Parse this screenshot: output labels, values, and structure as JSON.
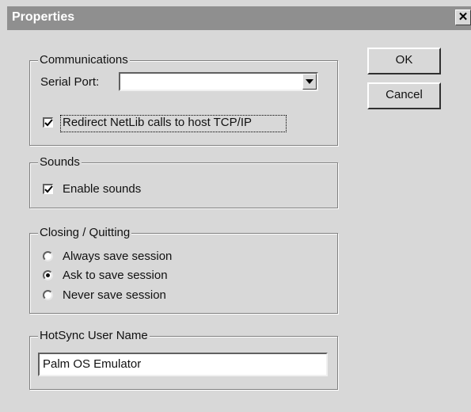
{
  "window": {
    "title": "Properties",
    "close_glyph": "✕"
  },
  "buttons": {
    "ok_label": "OK",
    "cancel_label": "Cancel"
  },
  "communications": {
    "group_label": "Communications",
    "serial_port_label": "Serial Port:",
    "serial_port_value": "",
    "redirect_label": "Redirect NetLib calls to host TCP/IP",
    "redirect_checked": true
  },
  "sounds": {
    "group_label": "Sounds",
    "enable_label": "Enable sounds",
    "enable_checked": true
  },
  "closing": {
    "group_label": "Closing / Quitting",
    "options": [
      {
        "label": "Always save session",
        "selected": false
      },
      {
        "label": "Ask to save session",
        "selected": true
      },
      {
        "label": "Never save session",
        "selected": false
      }
    ]
  },
  "hotsync": {
    "group_label": "HotSync User Name",
    "value": "Palm OS Emulator"
  },
  "icons": {
    "close": "close-icon",
    "dropdown": "chevron-down-icon",
    "check": "checkmark-icon"
  }
}
